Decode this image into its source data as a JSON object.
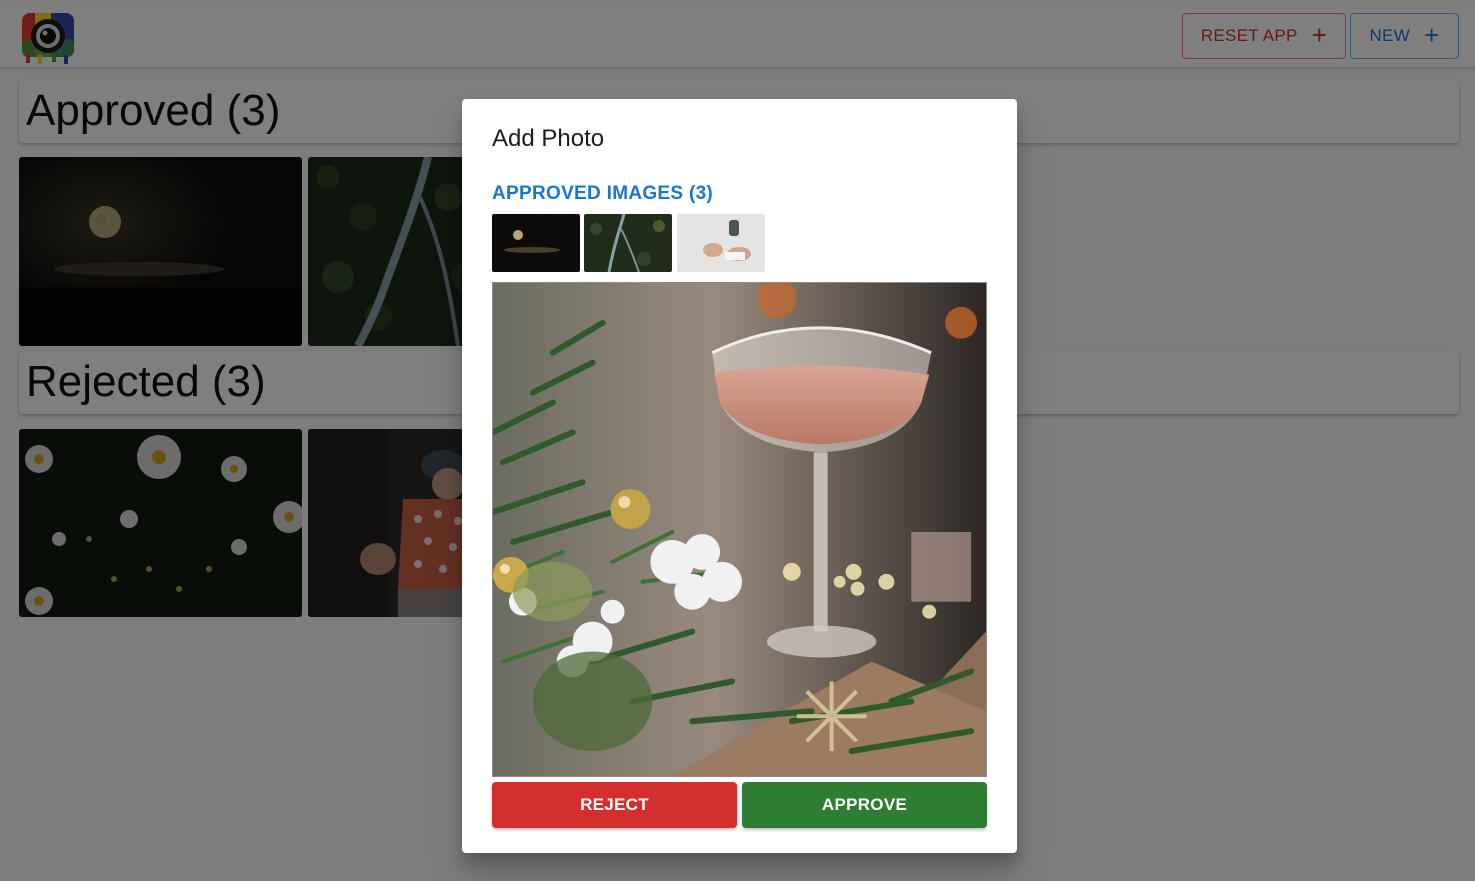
{
  "topbar": {
    "logo_icon": "camera-logo-icon",
    "reset_label": "RESET APP",
    "new_label": "NEW",
    "plus_glyph": "+",
    "reset_color": "#d32f2f",
    "new_color": "#1976d2"
  },
  "approved_section": {
    "heading": "Approved (3)",
    "thumbnails": [
      {
        "subject": "full moon over dark sea"
      },
      {
        "subject": "aerial forest with river"
      }
    ]
  },
  "rejected_section": {
    "heading": "Rejected (3)",
    "thumbnails": [
      {
        "subject": "white daisies at night"
      },
      {
        "subject": "child in polka-dot shirt"
      }
    ]
  },
  "dialog": {
    "title": "Add Photo",
    "approved_images_label": "APPROVED IMAGES (3)",
    "approved_thumbnails": [
      {
        "subject": "moon"
      },
      {
        "subject": "forest river"
      },
      {
        "subject": "hands and coffee"
      }
    ],
    "preview_subject": "pink drink in coupe glass with pine branches and ornaments",
    "reject_label": "REJECT",
    "approve_label": "APPROVE",
    "reject_color": "#d32f2f",
    "approve_color": "#2e7d32",
    "accent_color": "#1976d2"
  }
}
